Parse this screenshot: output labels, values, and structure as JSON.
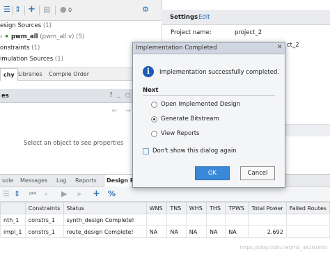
{
  "toolbar": {
    "count": "0"
  },
  "sources": {
    "design_sources": "esign Sources",
    "design_count": "(1)",
    "pwm_all_label": "pwm_all",
    "pwm_all_file": "(pwm_all.v) (5)",
    "constraints": "onstraints",
    "constraints_count": "(1)",
    "simulation_sources": "imulation Sources",
    "simulation_count": "(1)"
  },
  "source_tabs": [
    "chy",
    "Libraries",
    "Compile Order"
  ],
  "properties_panel": {
    "title": "es",
    "empty_message": "Select an object to see properties",
    "help_label": "?"
  },
  "settings": {
    "tab": "Settings",
    "edit_link": "Edit",
    "project_name_label": "Project name:",
    "project_name_value": "project_2",
    "project_location_fragment": "ct_2"
  },
  "bottom_tabs": [
    "sole",
    "Messages",
    "Log",
    "Reports",
    "Design Ru"
  ],
  "runs_table": {
    "columns": [
      "",
      "Constraints",
      "Status",
      "WNS",
      "TNS",
      "WHS",
      "THS",
      "TPWS",
      "Total Power",
      "Failed Routes"
    ],
    "rows": [
      [
        "nth_1",
        "constrs_1",
        "synth_design Complete!",
        "",
        "",
        "",
        "",
        "",
        "",
        ""
      ],
      [
        "impl_1",
        "constrs_1",
        "route_design Complete!",
        "NA",
        "NA",
        "NA",
        "NA",
        "NA",
        "2.692",
        ""
      ]
    ]
  },
  "dialog": {
    "title": "Implementation Completed",
    "message": "Implementation successfully completed.",
    "next_label": "Next",
    "options": [
      "Open Implemented Design",
      "Generate Bitstream",
      "View Reports"
    ],
    "selected_option": "Generate Bitstream",
    "dont_show_label": "Don't show this dialog again",
    "ok_label": "OK",
    "cancel_label": "Cancel"
  },
  "watermark": "https://blog.csdn.net/m0_46161655",
  "colors": {
    "accent": "#2c6fb6",
    "primary_button": "#3a88d8",
    "info_icon": "#1a5cb6"
  }
}
